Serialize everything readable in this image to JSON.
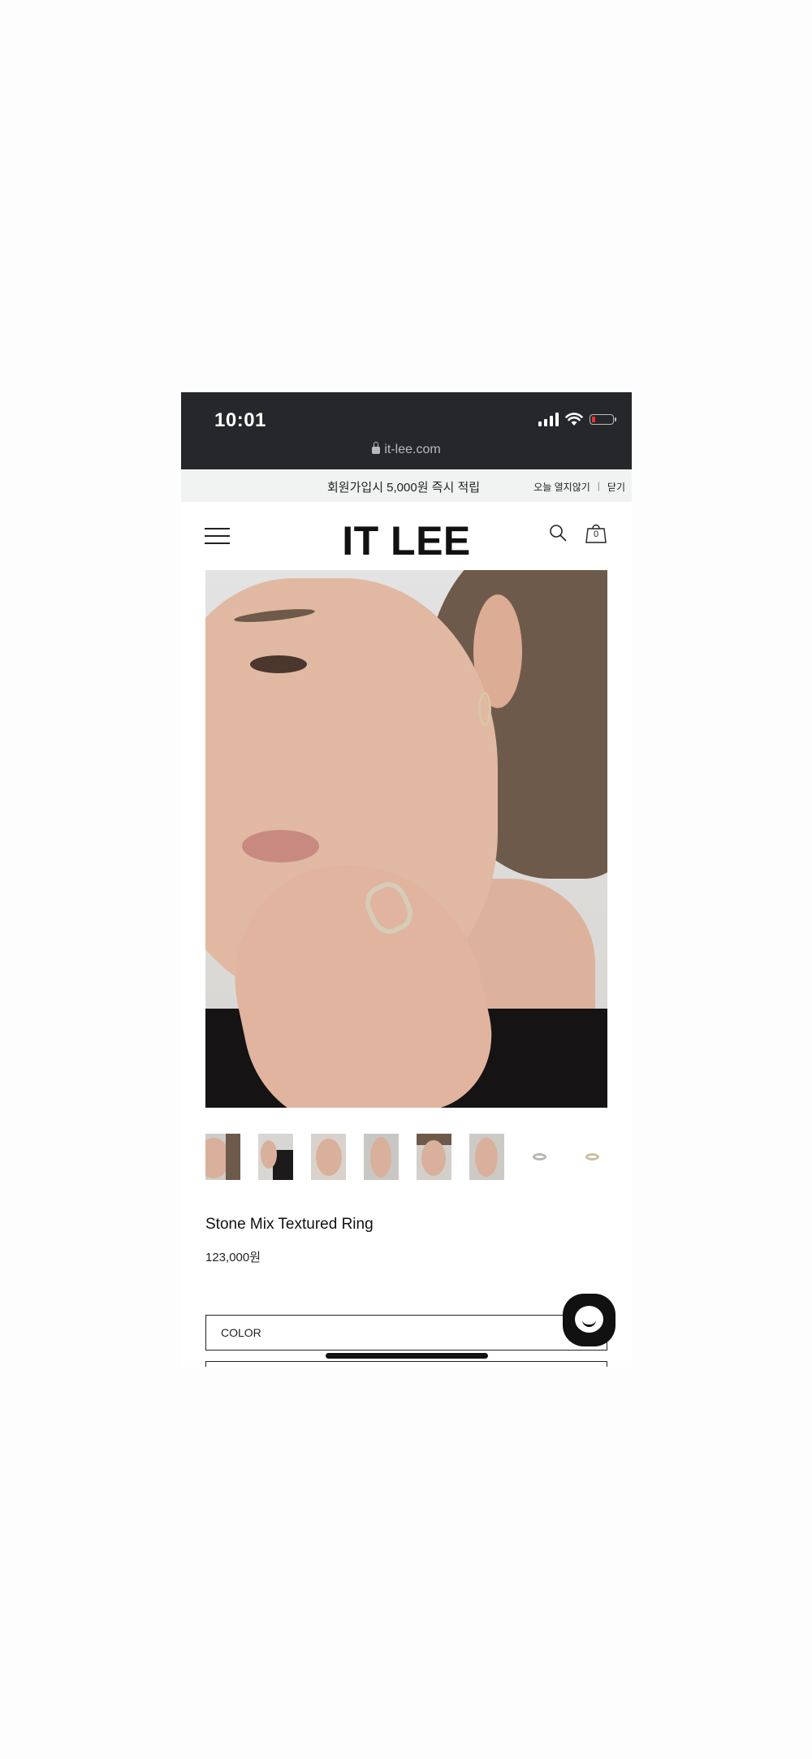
{
  "status_bar": {
    "time": "10:01",
    "url": "it-lee.com"
  },
  "promo": {
    "message": "회원가입시 5,000원 즉시 적립",
    "hide_today": "오늘 열지않기",
    "separator": "|",
    "close": "닫기"
  },
  "header": {
    "logo": "IT LEE",
    "cart_count": "0"
  },
  "gallery": {
    "thumbnail_count": 8
  },
  "product": {
    "name": "Stone Mix Textured Ring",
    "price": "123,000원"
  },
  "options": {
    "color_label": "COLOR"
  },
  "colors": {
    "status_bar_bg": "#26272b",
    "promo_bg": "#f1f2f2",
    "text": "#111111"
  }
}
